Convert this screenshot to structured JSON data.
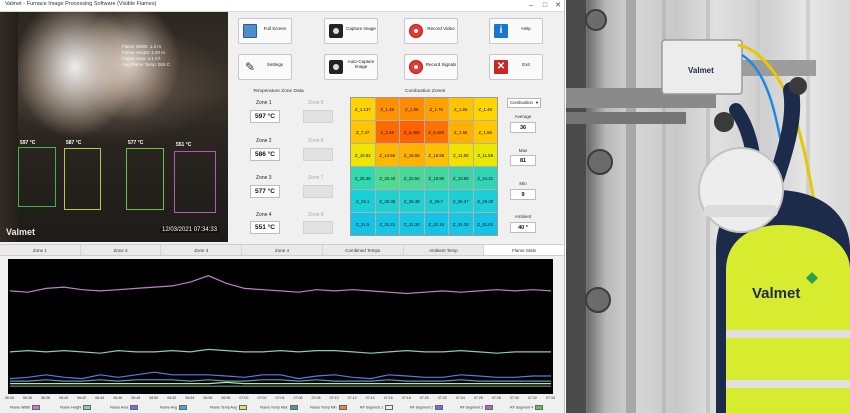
{
  "app": {
    "title": "Valmet - Furnace Image Processing Software (Visible Flames)"
  },
  "camera": {
    "info_lines": [
      "Flame Width: 1.3 m",
      "Flame Height: 2.40 m",
      "Flame Area: 4.1 m²",
      "Avg Flame Temp: 915 C"
    ],
    "zone_tags": [
      "597 °C",
      "587 °C",
      "577 °C",
      "551 °C"
    ],
    "logo_text": "Valmet",
    "timestamp": "12/03/2021 07:34:33"
  },
  "buttons": {
    "full_screen": "Full Screen",
    "capture_image": "Capture Image",
    "record_video": "Record Video",
    "help": "Help",
    "settings": "Settings",
    "auto_capture": "Auto-Capture Image",
    "record_signals": "Record Signals",
    "exit": "Exit"
  },
  "temperature_zones": {
    "title": "Temperature Zone Data",
    "zones": [
      {
        "label": "Zone 1",
        "value": "597 °C"
      },
      {
        "label": "Zone 2",
        "value": "586 °C"
      },
      {
        "label": "Zone 3",
        "value": "577 °C"
      },
      {
        "label": "Zone 4",
        "value": "551 °C"
      }
    ],
    "inactive_zones": [
      {
        "label": "Zone 5"
      },
      {
        "label": "Zone 6"
      },
      {
        "label": "Zone 7"
      },
      {
        "label": "Zone 8"
      }
    ]
  },
  "combustion_zones": {
    "title": "Combustion Zones",
    "cells": [
      [
        "Z_1.137",
        "Z_1.48",
        "Z_1.56",
        "Z_1.76",
        "Z_1.56",
        "Z_1.48"
      ],
      [
        "Z_7.47",
        "Z_2.48",
        "Z_6.483",
        "Z_6.483",
        "Z_1.55",
        "Z_1.56"
      ],
      [
        "Z_10.52",
        "Z_14.56",
        "Z_15.55",
        "Z_15.55",
        "Z_11.55",
        "Z_11.58"
      ],
      [
        "Z_25.35",
        "Z_20.33",
        "Z_20.60",
        "Z_10.80",
        "Z_10.65",
        "Z_24.21"
      ],
      [
        "Z_25.1",
        "Z_26.38",
        "Z_26.38",
        "Z_26.7",
        "Z_26.37",
        "Z_26.30"
      ],
      [
        "Z_31.5",
        "Z_31.21",
        "Z_31.30",
        "Z_31.10",
        "Z_31.30",
        "Z_31.01"
      ]
    ],
    "colors": [
      [
        "#ffd400",
        "#ff9100",
        "#ff8c00",
        "#ffa200",
        "#ffc400",
        "#ffd500"
      ],
      [
        "#ffc400",
        "#ff6a00",
        "#ff6000",
        "#ff7200",
        "#ffb000",
        "#ffc800"
      ],
      [
        "#f0e500",
        "#ffb800",
        "#ffb000",
        "#ffc000",
        "#f2e000",
        "#e8e800"
      ],
      [
        "#30d8b0",
        "#50dc90",
        "#4ad89a",
        "#44d6a0",
        "#3ed4a8",
        "#32d4b8"
      ],
      [
        "#1ad0d8",
        "#22d0d0",
        "#22d0d0",
        "#20d0d2",
        "#20cfd4",
        "#1cced8"
      ],
      [
        "#14c4e6",
        "#16c6e2",
        "#16c6e2",
        "#14c4e6",
        "#16c6e2",
        "#14c4e6"
      ]
    ]
  },
  "right_panel": {
    "dropdown_value": "Combustion",
    "stats": [
      {
        "label": "Average",
        "value": "36"
      },
      {
        "label": "Max",
        "value": "81"
      },
      {
        "label": "Min",
        "value": "9"
      },
      {
        "label": "Ambient",
        "value": "40 °"
      }
    ]
  },
  "tabs": [
    "Zone 1",
    "Zone 2",
    "Zone 3",
    "Zone 4",
    "Combined Temps",
    "Ambient Temp",
    "Flame Stats"
  ],
  "active_tab_index": 6,
  "chart_data": {
    "type": "line",
    "x": [
      "06:34",
      "06:36",
      "06:38",
      "06:40",
      "06:42",
      "06:44",
      "06:46",
      "06:48",
      "06:50",
      "06:52",
      "06:54",
      "06:56",
      "06:58",
      "07:00",
      "07:02",
      "07:04",
      "07:06",
      "07:08",
      "07:10",
      "07:12",
      "07:14",
      "07:16",
      "07:18",
      "07:20",
      "07:22",
      "07:24",
      "07:26",
      "07:28",
      "07:30",
      "07:32",
      "07:34"
    ],
    "series": [
      {
        "name": "Flame Width",
        "color": "#c080c8",
        "values": [
          78,
          77,
          80,
          81,
          79,
          78,
          79,
          80,
          81,
          82,
          85,
          90,
          84,
          80,
          79,
          78,
          77,
          79,
          78,
          79,
          78,
          77,
          76,
          77,
          78,
          77,
          78,
          79,
          78,
          79,
          78
        ]
      },
      {
        "name": "Flame Height",
        "color": "#8cc8c0",
        "values": [
          30,
          31,
          30,
          31,
          30,
          29,
          31,
          30,
          30,
          31,
          30,
          32,
          31,
          30,
          30,
          31,
          30,
          31,
          31,
          30,
          29,
          30,
          31,
          30,
          30,
          31,
          30,
          29,
          30,
          30,
          30
        ]
      },
      {
        "name": "Flame Area",
        "color": "#6a74e0",
        "values": [
          9,
          10,
          12,
          10,
          9,
          12,
          10,
          12,
          14,
          12,
          12,
          12,
          11,
          10,
          12,
          12,
          9,
          11,
          12,
          10,
          9,
          12,
          11,
          10,
          10,
          12,
          11,
          10,
          10,
          11,
          11
        ]
      },
      {
        "name": "Flame Avg",
        "color": "#40a8e0",
        "values": [
          7,
          7,
          8,
          7,
          7,
          8,
          7,
          8,
          8,
          8,
          7,
          8,
          7,
          7,
          8,
          8,
          7,
          8,
          7,
          7,
          7,
          8,
          7,
          7,
          7,
          8,
          7,
          7,
          7,
          7,
          7
        ]
      },
      {
        "name": "Flame Max",
        "color": "#e0e060",
        "values": [
          5,
          5,
          5,
          5,
          5,
          5,
          5,
          5,
          5,
          5,
          5,
          5,
          6,
          5,
          5,
          5,
          5,
          5,
          5,
          5,
          5,
          5,
          5,
          5,
          5,
          5,
          5,
          5,
          5,
          5,
          5
        ]
      },
      {
        "name": "Flame Min",
        "color": "#4c9c9c",
        "values": [
          3,
          3,
          3,
          3,
          3,
          3,
          3,
          3,
          3,
          3,
          3,
          3,
          3,
          3,
          3,
          3,
          3,
          3,
          3,
          3,
          3,
          3,
          3,
          3,
          3,
          3,
          3,
          3,
          3,
          3,
          3
        ]
      }
    ],
    "legend": [
      "Flame Width",
      "Flame Height",
      "Flame Area",
      "Flame Avg",
      "Flame Temp Avg",
      "Flame Temp Max",
      "Flame Temp Min",
      "RF Segment 1",
      "RF Segment 2",
      "RF Segment 3",
      "RF Segment 4"
    ],
    "legend_colors": [
      "#c080c8",
      "#8cc8c0",
      "#6a74e0",
      "#40a8e0",
      "#e0e060",
      "#4c9c9c",
      "#dd8844",
      "#eeeeee",
      "#7070d0",
      "#c060c0",
      "#60c060"
    ],
    "ylim": [
      0,
      100
    ],
    "grid": false
  },
  "photo": {
    "housing_brand": "Valmet",
    "jacket_brand": "Valmet"
  }
}
